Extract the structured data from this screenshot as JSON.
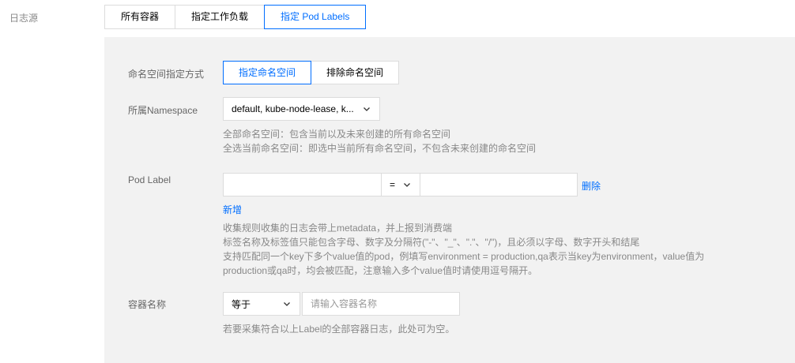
{
  "source": {
    "label": "日志源",
    "tabs": [
      {
        "label": "所有容器",
        "active": false
      },
      {
        "label": "指定工作负载",
        "active": false
      },
      {
        "label": "指定 Pod Labels",
        "active": true
      }
    ]
  },
  "namespace_mode": {
    "label": "命名空间指定方式",
    "options": [
      {
        "label": "指定命名空间",
        "active": true
      },
      {
        "label": "排除命名空间",
        "active": false
      }
    ]
  },
  "namespace": {
    "label": "所属Namespace",
    "selected": "default, kube-node-lease, k...",
    "help": [
      "全部命名空间：包含当前以及未来创建的所有命名空间",
      "全选当前命名空间：即选中当前所有命名空间，不包含未来创建的命名空间"
    ]
  },
  "pod_label": {
    "label": "Pod Label",
    "key_value": "",
    "operator": "=",
    "value_value": "",
    "delete_label": "删除",
    "add_label": "新增",
    "help": [
      "收集规则收集的日志会带上metadata，并上报到消费端",
      "标签名称及标签值只能包含字母、数字及分隔符(\"-\"、\"_\"、\".\"、\"/\")，且必须以字母、数字开头和结尾",
      "支持匹配同一个key下多个value值的pod，例填写environment = production,qa表示当key为environment，value值为",
      "production或qa时，均会被匹配，注意输入多个value值时请使用逗号隔开。"
    ]
  },
  "container_name": {
    "label": "容器名称",
    "operator": "等于",
    "placeholder": "请输入容器名称",
    "help": "若要采集符合以上Label的全部容器日志，此处可为空。"
  },
  "colors": {
    "accent": "#006eff",
    "panel_bg": "#f2f2f2",
    "border": "#dcdcdc",
    "label": "#666666",
    "help": "#888888"
  },
  "icons": {
    "dropdown": "chevron-down-icon"
  }
}
